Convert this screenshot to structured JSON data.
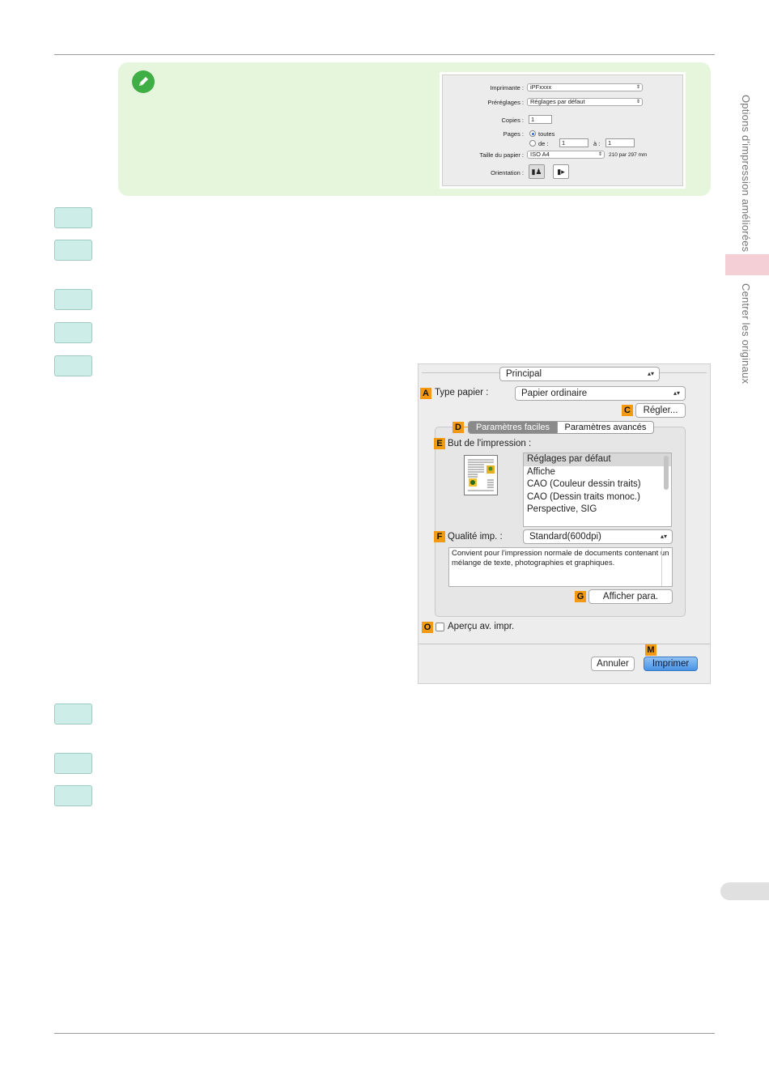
{
  "side_tabs": {
    "section_1": "Options d'impression améliorées",
    "section_2": "Centrer les originaux"
  },
  "note_panel": {
    "printer_label": "Imprimante :",
    "printer_value": "iPFxxxx",
    "presets_label": "Préréglages :",
    "presets_value": "Réglages par défaut",
    "copies_label": "Copies :",
    "copies_value": "1",
    "pages_label": "Pages :",
    "pages_all": "toutes",
    "pages_from": "de :",
    "pages_from_value": "1",
    "pages_to": "à :",
    "pages_to_value": "1",
    "paper_size_label": "Taille du papier :",
    "paper_size_value": "ISO A4",
    "paper_size_dims": "210 par 297 mm",
    "orientation_label": "Orientation :"
  },
  "dialog": {
    "panel_select": "Principal",
    "badges": {
      "a": "A",
      "c": "C",
      "d": "D",
      "e": "E",
      "f": "F",
      "g": "G",
      "o": "O",
      "m": "M"
    },
    "paper_type_label": "Type papier :",
    "paper_type_value": "Papier ordinaire",
    "adjust_button": "Régler...",
    "tab_easy": "Paramètres faciles",
    "tab_advanced": "Paramètres avancés",
    "print_purpose_label": "But de l'impression :",
    "print_purpose_items": [
      "Réglages par défaut",
      "Affiche",
      "CAO (Couleur dessin traits)",
      "CAO (Dessin traits monoc.)",
      "Perspective, SIG"
    ],
    "quality_label": "Qualité imp. :",
    "quality_value": "Standard(600dpi)",
    "description": "Convient pour l'impression normale de documents contenant un mélange de texte, photographies et graphiques.",
    "show_settings_button": "Afficher para.",
    "preview_label": "Aperçu av. impr.",
    "cancel_button": "Annuler",
    "print_button": "Imprimer"
  },
  "colors": {
    "note_bg": "#e6f6dc",
    "step_bg": "#cdeee8",
    "badge": "#f39a12",
    "side_pink": "#f4d0d6"
  }
}
